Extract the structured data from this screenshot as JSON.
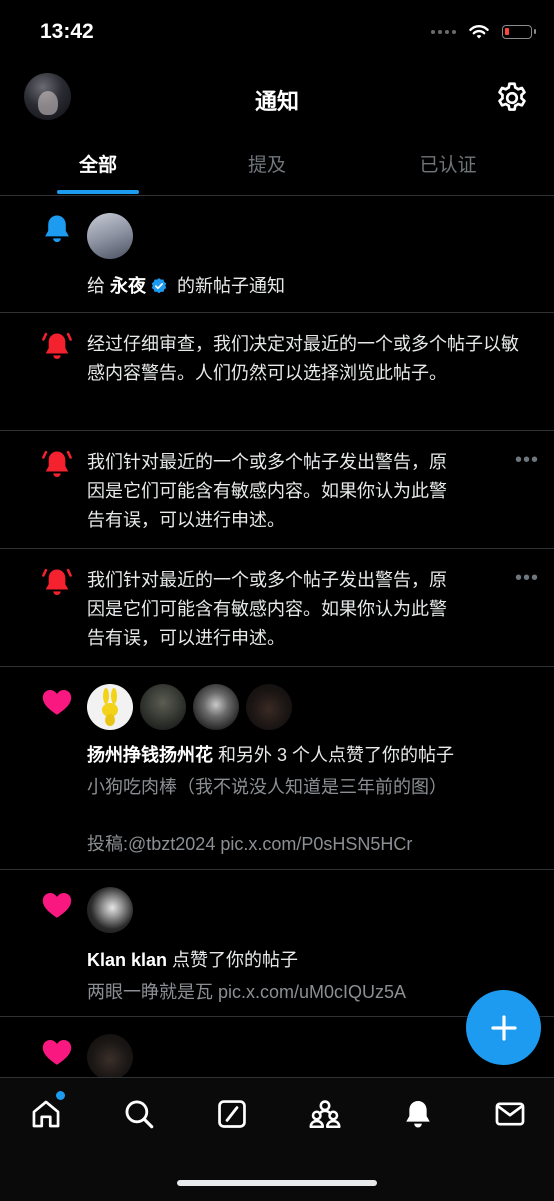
{
  "status_bar": {
    "time": "13:42"
  },
  "header": {
    "title": "通知"
  },
  "tabs": [
    {
      "label": "全部",
      "active": true
    },
    {
      "label": "提及",
      "active": false
    },
    {
      "label": "已认证",
      "active": false
    }
  ],
  "notifications": [
    {
      "icon": "bell-icon",
      "prefix": "给 ",
      "user": "永夜",
      "suffix": " 的新帖子通知"
    },
    {
      "icon": "alert-bell-icon",
      "text": "经过仔细审查，我们决定对最近的一个或多个帖子以敏感内容警告。人们仍然可以选择浏览此帖子。"
    },
    {
      "icon": "alert-bell-icon",
      "text": "我们针对最近的一个或多个帖子发出警告，原因是它们可能含有敏感内容。如果你认为此警告有误，可以进行申述。",
      "more": "•••"
    },
    {
      "icon": "alert-bell-icon",
      "text": "我们针对最近的一个或多个帖子发出警告，原因是它们可能含有敏感内容。如果你认为此警告有误，可以进行申述。",
      "more": "•••"
    },
    {
      "icon": "heart-icon",
      "user": "扬州挣钱扬州花",
      "action": " 和另外 3 个人点赞了你的帖子",
      "post_line1": "小狗吃肉棒（我不说没人知道是三年前的图）",
      "post_line2": "投稿:@tbzt2024 pic.x.com/P0sHSN5HCr"
    },
    {
      "icon": "heart-icon",
      "user": "Klan klan",
      "action": " 点赞了你的帖子",
      "post_line1": "两眼一睁就是瓦 pic.x.com/uM0cIQUz5A"
    },
    {
      "icon": "heart-icon"
    }
  ],
  "colors": {
    "accent": "#1d9bf0",
    "alert": "#f4212e",
    "like": "#f91880"
  },
  "nav": [
    "home-icon",
    "search-icon",
    "grok-icon",
    "communities-icon",
    "notifications-icon",
    "messages-icon"
  ]
}
